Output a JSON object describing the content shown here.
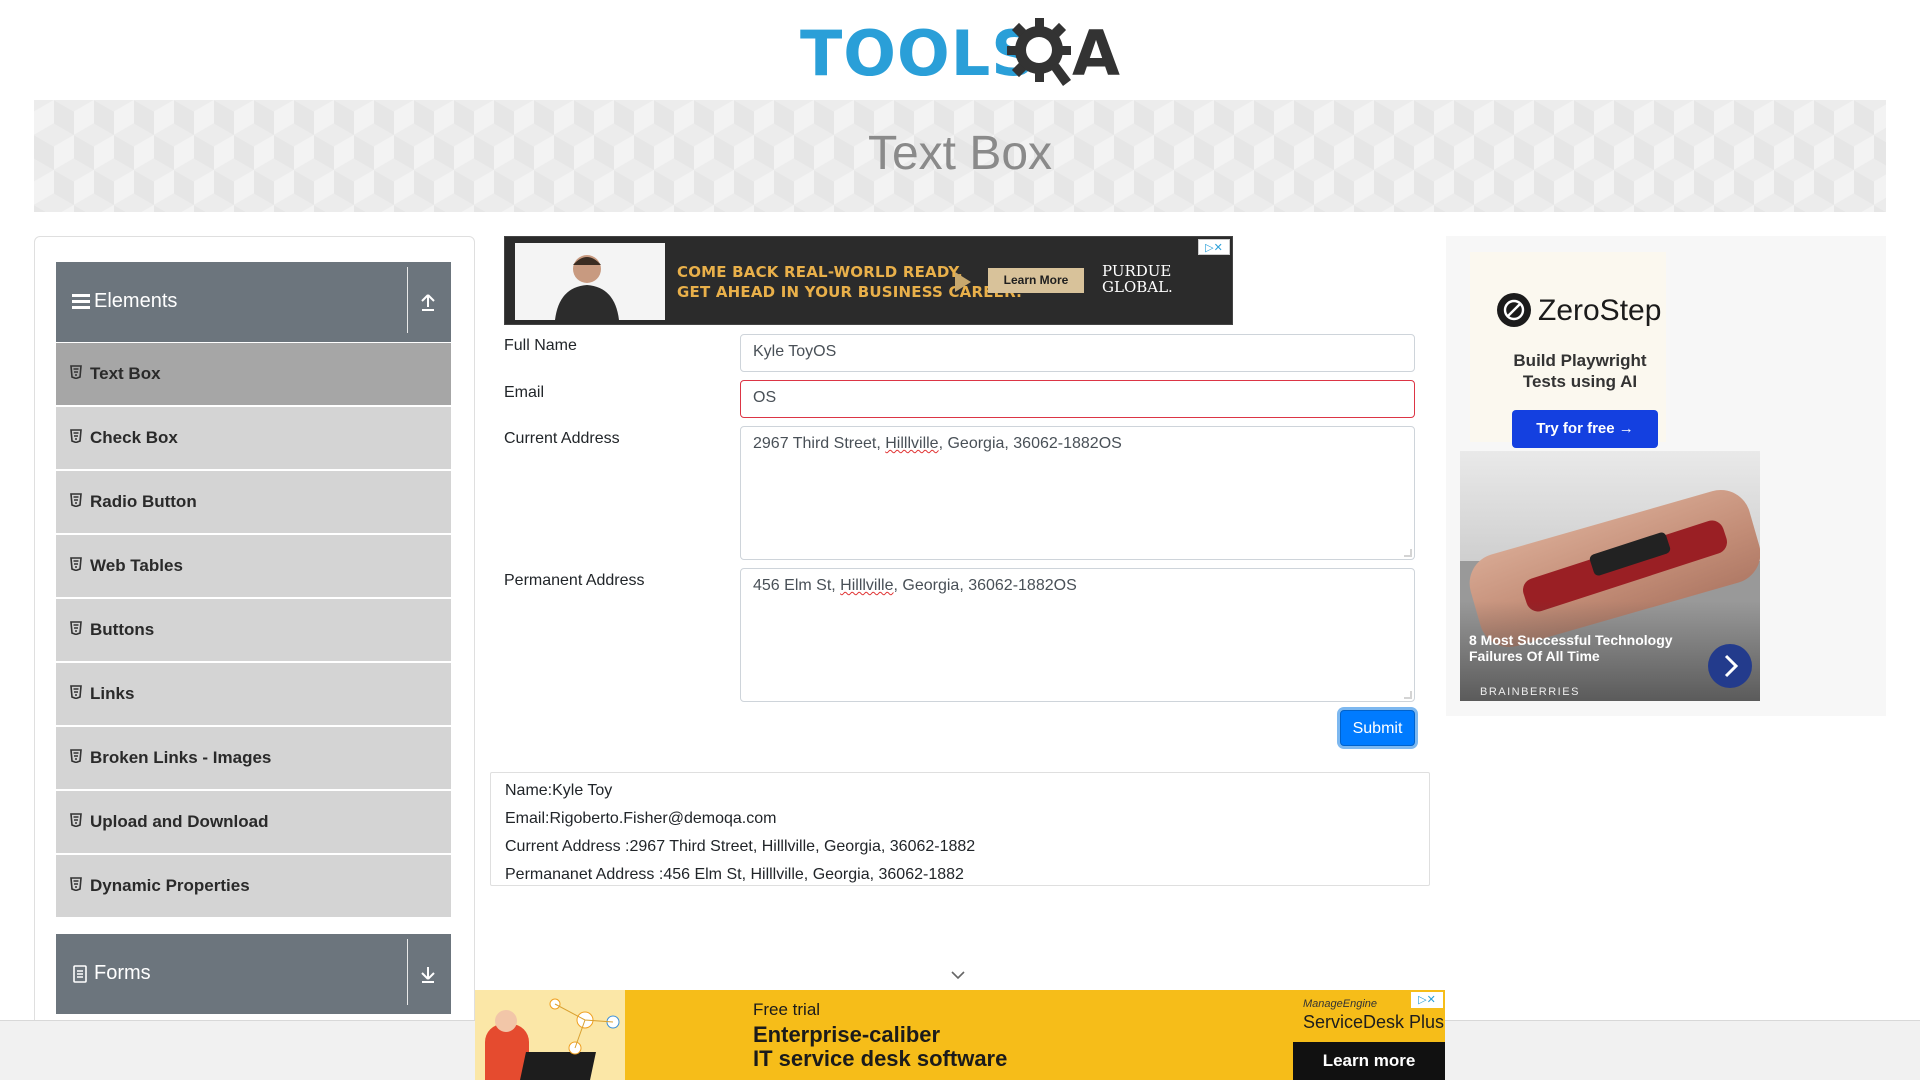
{
  "header": {
    "logo_text": "TOOLS",
    "logo_text_end": "A"
  },
  "banner": {
    "title": "Text Box"
  },
  "sidebar": {
    "elements_group": "Elements",
    "items": [
      {
        "label": "Text Box",
        "active": true
      },
      {
        "label": "Check Box"
      },
      {
        "label": "Radio Button"
      },
      {
        "label": "Web Tables"
      },
      {
        "label": "Buttons"
      },
      {
        "label": "Links"
      },
      {
        "label": "Broken Links - Images"
      },
      {
        "label": "Upload and Download"
      },
      {
        "label": "Dynamic Properties"
      }
    ],
    "forms_group": "Forms"
  },
  "ad_top": {
    "line1": "COME BACK REAL-WORLD READY.",
    "line2": "GET AHEAD IN YOUR BUSINESS CAREER.",
    "button": "Learn More",
    "brand1": "PURDUE",
    "brand2": "GLOBAL."
  },
  "form": {
    "full_name_label": "Full Name",
    "full_name_value": "Kyle ToyOS",
    "email_label": "Email",
    "email_value": "OS",
    "current_address_label": "Current Address",
    "current_address_pre": "2967 Third Street, ",
    "current_address_word": "Hilllville",
    "current_address_post": ", Georgia, 36062-1882OS",
    "permanent_address_label": "Permanent Address",
    "permanent_address_pre": "456 Elm St, ",
    "permanent_address_word": "Hilllville",
    "permanent_address_post": ", Georgia, 36062-1882OS",
    "submit_label": "Submit"
  },
  "output": {
    "name": "Name:Kyle Toy",
    "email": "Email:Rigoberto.Fisher@demoqa.com",
    "current_address": "Current Address :2967 Third Street, Hilllville, Georgia, 36062-1882",
    "permanent_address": "Permananet Address :456 Elm St, Hilllville, Georgia, 36062-1882"
  },
  "ad_right": {
    "brand": "ZeroStep",
    "subtitle_line1": "Build Playwright",
    "subtitle_line2": "Tests using AI",
    "button": "Try for free →",
    "promo_title": "8 Most Successful Technology Failures Of All Time",
    "promo_brand": "BRAINBERRIES"
  },
  "ad_bottom": {
    "small": "Free trial",
    "line1": "Enterprise-caliber",
    "line2": "IT service desk software",
    "brand_small": "ManageEngine",
    "brand": "ServiceDesk Plus",
    "button": "Learn more"
  },
  "colors": {
    "accent": "#007bff",
    "sidebar_header": "#6c757d",
    "sidebar_item": "#d4d4d4",
    "sidebar_item_active": "#a6a6a6",
    "error_border": "#dc3545"
  }
}
